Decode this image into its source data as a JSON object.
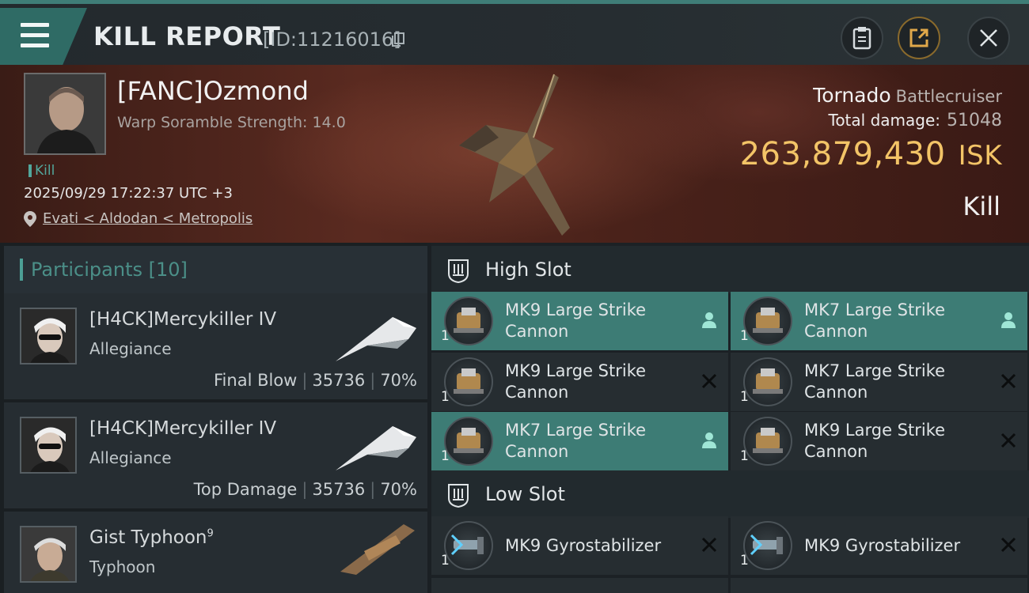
{
  "header": {
    "title": "KILL REPORT",
    "report_id": "[ID:11216016]"
  },
  "victim": {
    "name": "[FANC]Ozmond",
    "attribute": "Warp Soramble Strength: 14.0",
    "kill_tag": "Kill",
    "datetime": "2025/09/29 17:22:37 UTC +3",
    "location": "Evati < Aldodan < Metropolis",
    "ship_name": "Tornado",
    "ship_class": "Battlecruiser",
    "total_damage_label": "Total damage:",
    "total_damage": "51048",
    "isk_value": "263,879,430",
    "isk_unit": "ISK",
    "result": "Kill"
  },
  "participants": {
    "label": "Participants",
    "count": "[10]",
    "items": [
      {
        "name": "[H4CK]Mercykiller IV",
        "ship": "Allegiance",
        "role": "Final Blow",
        "damage": "35736",
        "percent": "70%"
      },
      {
        "name": "[H4CK]Mercykiller IV",
        "ship": "Allegiance",
        "role": "Top Damage",
        "damage": "35736",
        "percent": "70%"
      },
      {
        "name": "Gist Typhoon",
        "sup": "9",
        "ship": "Typhoon"
      }
    ]
  },
  "slots": {
    "high_label": "High Slot",
    "low_label": "Low Slot",
    "high": [
      {
        "qty": "1",
        "name": "MK9 Large Strike Cannon",
        "state": "dropped"
      },
      {
        "qty": "1",
        "name": "MK7 Large Strike Cannon",
        "state": "dropped"
      },
      {
        "qty": "1",
        "name": "MK9 Large Strike Cannon",
        "state": "destroyed"
      },
      {
        "qty": "1",
        "name": "MK7 Large Strike Cannon",
        "state": "destroyed"
      },
      {
        "qty": "1",
        "name": "MK7 Large Strike Cannon",
        "state": "dropped"
      },
      {
        "qty": "1",
        "name": "MK9 Large Strike Cannon",
        "state": "destroyed"
      }
    ],
    "low": [
      {
        "qty": "1",
        "name": "MK9 Gyrostabilizer",
        "state": "destroyed"
      },
      {
        "qty": "1",
        "name": "MK9 Gyrostabilizer",
        "state": "destroyed"
      }
    ]
  },
  "colors": {
    "accent": "#3d7c75",
    "isk": "#f3c467",
    "kill_tag": "#52a79c"
  },
  "icons": {
    "menu": "hamburger-icon",
    "copy": "copy-icon",
    "clipboard": "clipboard-icon",
    "share": "share-icon",
    "close": "close-icon",
    "location": "location-pin-icon",
    "dropped": "person-icon",
    "destroyed": "x-icon"
  }
}
